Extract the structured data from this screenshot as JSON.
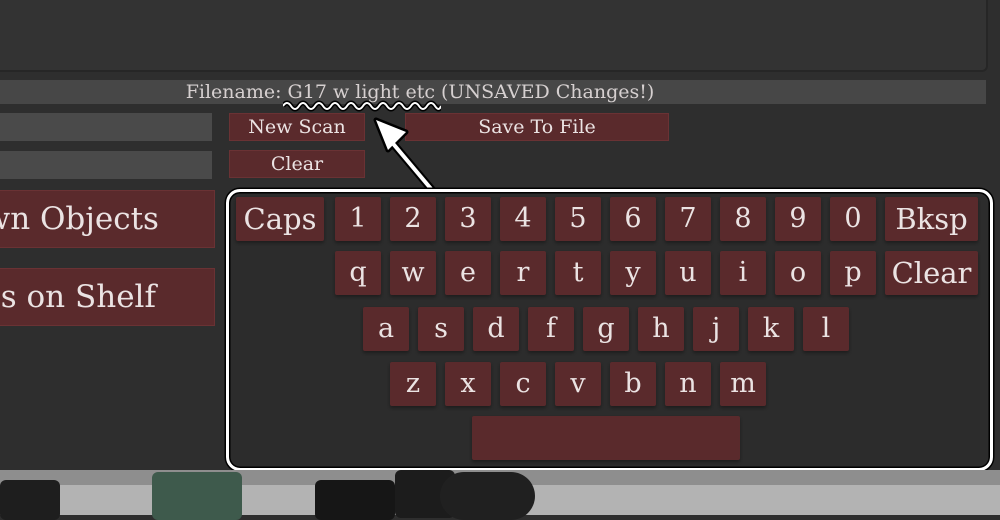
{
  "top_panel": {
    "filename_text": "Filename: G17 w light etc (UNSAVED Changes!)"
  },
  "controls": {
    "new_scan_label": "New Scan",
    "save_to_file_label": "Save To File",
    "clear_label": "Clear"
  },
  "sidebar": {
    "known_objects_label": "own Objects",
    "items_on_shelf_label": "ems on Shelf"
  },
  "keyboard": {
    "row1": [
      "Caps",
      "1",
      "2",
      "3",
      "4",
      "5",
      "6",
      "7",
      "8",
      "9",
      "0",
      "Bksp"
    ],
    "row2": [
      "q",
      "w",
      "e",
      "r",
      "t",
      "y",
      "u",
      "i",
      "o",
      "p",
      "Clear"
    ],
    "row3": [
      "a",
      "s",
      "d",
      "f",
      "g",
      "h",
      "j",
      "k",
      "l"
    ],
    "row4": [
      "z",
      "x",
      "c",
      "v",
      "b",
      "n",
      "m"
    ],
    "space_label": ""
  },
  "colors": {
    "button_red": "#5a2a2c",
    "panel_dark": "#2e2e2e",
    "highlight_outline": "#ffffff"
  },
  "icons": [
    "arrow-pointer-icon",
    "spellcheck-squiggle"
  ]
}
